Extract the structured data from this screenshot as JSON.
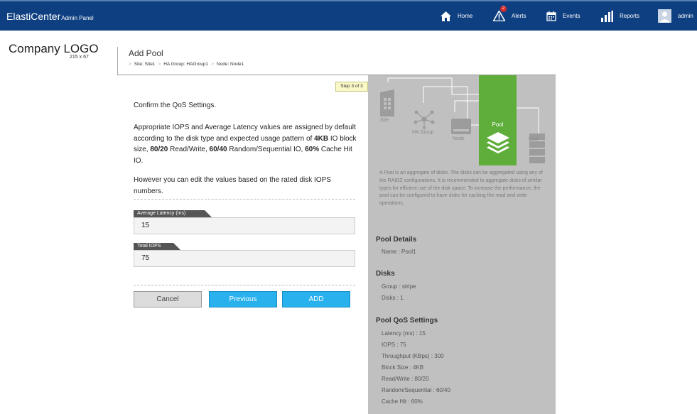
{
  "header": {
    "brand": "ElastiCenter",
    "brand_sub": "Admin Panel",
    "nav": {
      "home": "Home",
      "alerts": "Alerts",
      "alerts_count": "2",
      "events": "Events",
      "reports": "Reports",
      "user": "admin"
    }
  },
  "logo": {
    "text": "Company LOGO",
    "size": "215 x 67"
  },
  "page": {
    "title": "Add Pool",
    "breadcrumb": [
      "Site: Site1",
      "HA Group: HAGroup1",
      "Node: Node1"
    ]
  },
  "form": {
    "step": "Step 3 of 3",
    "confirm": "Confirm the QoS Settings.",
    "para1": {
      "a": "Appropriate IOPS and Average Latency values are assigned by default according to the disk type and expected usage pattern of ",
      "b1": "4KB",
      "c": " IO block size, ",
      "b2": "80/20",
      "d": " Read/Write, ",
      "b3": "60/40",
      "e": " Random/Sequential IO, ",
      "b4": "60%",
      "f": " Cache Hit IO."
    },
    "para2": "However you can edit the values based on the rated disk IOPS numbers.",
    "latency_label": "Average Latency (ms)",
    "latency_value": "15",
    "iops_label": "Total IOPS",
    "iops_value": "75",
    "cancel": "Cancel",
    "previous": "Previous",
    "add": "ADD"
  },
  "panel": {
    "diagram": {
      "site": "Site",
      "ha_group": "HA Group",
      "node": "Node",
      "pool": "Pool",
      "disk": "Disk"
    },
    "description": "A Pool is an aggregate of disks. The disks can be aggregated using any of the RAIDZ configurations. It is recommended to aggregate disks of similar types for efficient use of the disk space. To increase the performance, the pool can be configured to have disks for caching the read and write operations.",
    "pool_details": {
      "title": "Pool Details",
      "name": "Name : Pool1"
    },
    "disks": {
      "title": "Disks",
      "group": "Group : stripe",
      "count": "Disks : 1"
    },
    "qos": {
      "title": "Pool QoS Settings",
      "items": [
        "Latency (ms) : 15",
        "IOPS : 75",
        "Throughput (KBps) : 300",
        "Block Size : 4KB",
        "Read/Write : 80/20",
        "Random/Sequential : 60/40",
        "Cache Hit : 60%"
      ]
    }
  }
}
